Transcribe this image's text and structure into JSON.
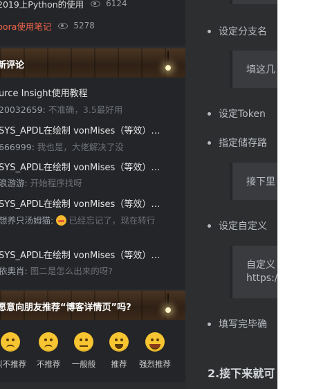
{
  "sidebar": {
    "top_links": [
      {
        "text": "2019上Python的使用",
        "views": "6124",
        "highlight": false
      },
      {
        "text": "pora使用笔记",
        "views": "5278",
        "highlight": true
      }
    ],
    "comments_header": "新评论",
    "comments": [
      {
        "title": "urce Insight使用教程",
        "user": "20032659",
        "text": "不准确，3.5最好用",
        "emoji": false
      },
      {
        "title": "SYS_APDL在绘制 vonMises（等效）…",
        "user": "666999",
        "text": "我也是，大佬解决了没",
        "emoji": false
      },
      {
        "title": "SYS_APDL在绘制 vonMises（等效）…",
        "user": "浪游游",
        "text": "开始程序找呀",
        "emoji": false
      },
      {
        "title": "SYS_APDL在绘制 vonMises（等效）…",
        "user": "想养只汤姆猫",
        "text": "已经忘记了，现在转行",
        "emoji": true
      },
      {
        "title": "SYS_APDL在绘制 vonMises（等效）…",
        "user": "依奥肖",
        "text": "图二是怎么出来的呀?",
        "emoji": false
      }
    ],
    "recommend_header": "愿意向朋友推荐“博客详情页”吗?",
    "recommend_options": [
      {
        "label": "烈不推荐",
        "icon": "angry-face-icon"
      },
      {
        "label": "不推荐",
        "icon": "frown-face-icon"
      },
      {
        "label": "一般般",
        "icon": "neutral-face-icon"
      },
      {
        "label": "推荐",
        "icon": "smile-face-icon"
      },
      {
        "label": "强烈推荐",
        "icon": "grin-face-icon"
      }
    ]
  },
  "article": {
    "items": [
      {
        "type": "bullet",
        "text": "设定分支名"
      },
      {
        "type": "quote",
        "lines": [
          "填这几"
        ]
      },
      {
        "type": "bullet",
        "text": "设定Token"
      },
      {
        "type": "bullet",
        "text": "指定储存路"
      },
      {
        "type": "quote",
        "lines": [
          "接下里"
        ]
      },
      {
        "type": "bullet",
        "text": "设定自定义"
      },
      {
        "type": "quote",
        "lines": [
          "自定义",
          "https:/"
        ]
      },
      {
        "type": "bullet",
        "text": "填写完毕确"
      }
    ],
    "heading": "2.接下来就可"
  },
  "colors": {
    "sidebar_bg": "#242528",
    "highlight_link": "#f0644a",
    "article_bg": "#2d2e30",
    "emoji_yellow": "#f7c531"
  }
}
